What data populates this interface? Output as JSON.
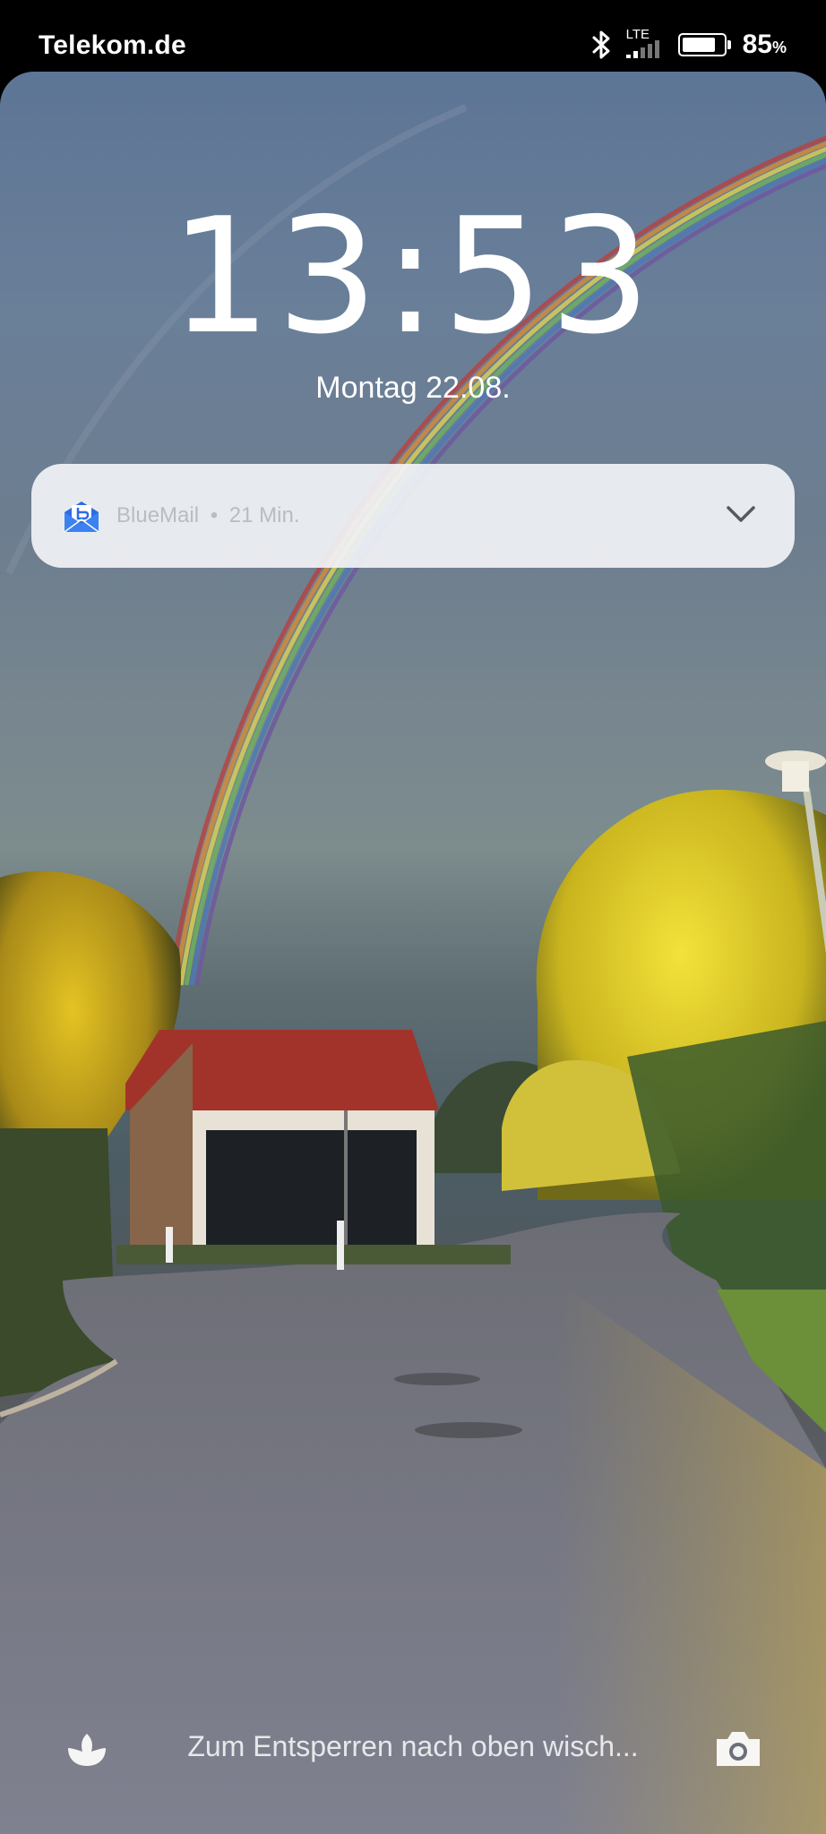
{
  "status_bar": {
    "carrier": "Telekom.de",
    "network": "LTE",
    "battery_percent": "85",
    "battery_unit": "%",
    "battery_level": 0.85,
    "icons": [
      "bluetooth-icon",
      "signal-icon",
      "battery-icon"
    ]
  },
  "lockscreen": {
    "time": "13:53",
    "date": "Montag 22.08."
  },
  "notification": {
    "app": "BlueMail",
    "separator": "•",
    "age": "21 Min.",
    "app_icon": "bluemail-icon",
    "expand_icon": "chevron-down-icon",
    "app_color": "#2a6ee5"
  },
  "bottom": {
    "unlock_hint": "Zum Entsperren nach oben wisch...",
    "left_icon": "magazine-unlock-icon",
    "right_icon": "camera-icon"
  }
}
